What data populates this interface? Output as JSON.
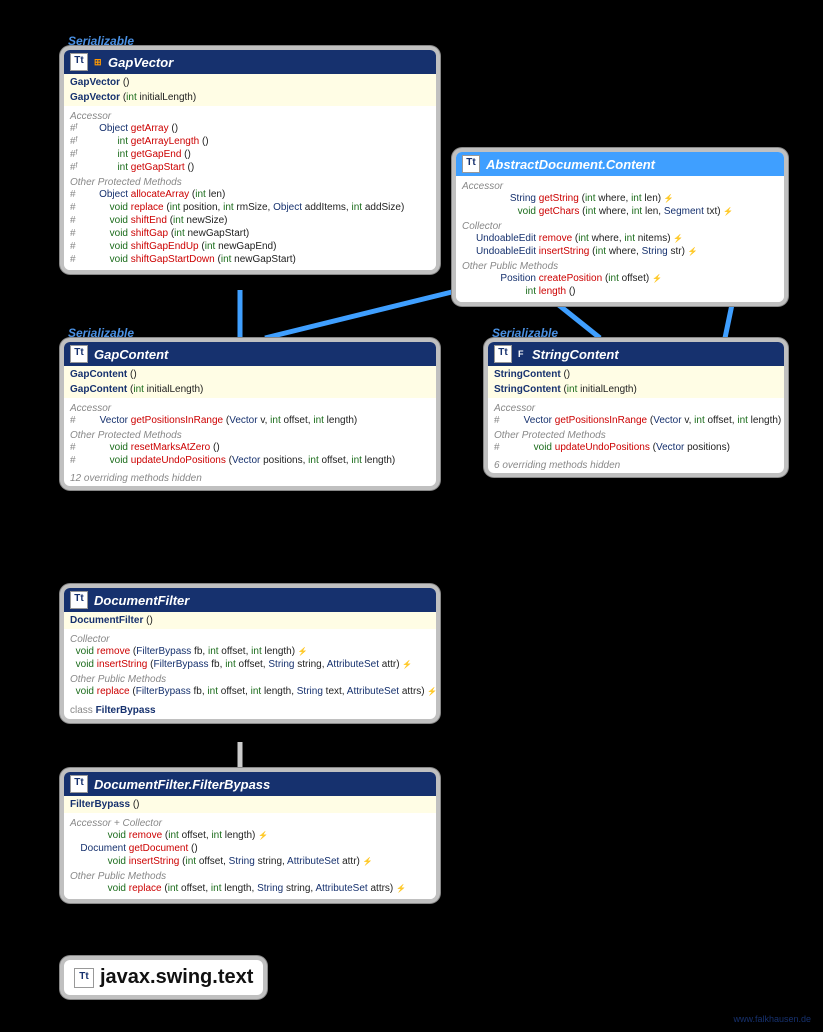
{
  "footer": "www.falkhausen.de",
  "serializable_label": "Serializable",
  "package": "javax.swing.text",
  "boxes": {
    "gapvector": {
      "title": "GapVector",
      "constructors": [
        {
          "name": "GapVector",
          "params": "()"
        },
        {
          "name": "GapVector",
          "params_html": "(<span class='param-primitive'>int</span> initialLength)"
        }
      ],
      "sections": [
        {
          "label": "Accessor",
          "rows": [
            {
              "mod": "#ᶠ",
              "ret": "Object",
              "name": "getArray",
              "params": "()"
            },
            {
              "mod": "#ᶠ",
              "ret": "int",
              "retprim": true,
              "name": "getArrayLength",
              "params": "()"
            },
            {
              "mod": "#ᶠ",
              "ret": "int",
              "retprim": true,
              "name": "getGapEnd",
              "params": "()"
            },
            {
              "mod": "#ᶠ",
              "ret": "int",
              "retprim": true,
              "name": "getGapStart",
              "params": "()"
            }
          ]
        },
        {
          "label": "Other Protected Methods",
          "rows": [
            {
              "mod": "#",
              "ret": "Object",
              "name": "allocateArray",
              "params_html": "(<span class='param-primitive'>int</span> len)"
            },
            {
              "mod": "#",
              "ret": "void",
              "retprim": true,
              "name": "replace",
              "params_html": "(<span class='param-primitive'>int</span> position, <span class='param-primitive'>int</span> rmSize, <span class='param-type'>Object</span> addItems, <span class='param-primitive'>int</span> addSize)"
            },
            {
              "mod": "#",
              "ret": "void",
              "retprim": true,
              "name": "shiftEnd",
              "params_html": "(<span class='param-primitive'>int</span> newSize)"
            },
            {
              "mod": "#",
              "ret": "void",
              "retprim": true,
              "name": "shiftGap",
              "params_html": "(<span class='param-primitive'>int</span> newGapStart)"
            },
            {
              "mod": "#",
              "ret": "void",
              "retprim": true,
              "name": "shiftGapEndUp",
              "params_html": "(<span class='param-primitive'>int</span> newGapEnd)"
            },
            {
              "mod": "#",
              "ret": "void",
              "retprim": true,
              "name": "shiftGapStartDown",
              "params_html": "(<span class='param-primitive'>int</span> newGapStart)"
            }
          ]
        }
      ]
    },
    "absdoc": {
      "title": "AbstractDocument.Content",
      "sections": [
        {
          "label": "Accessor",
          "rows": [
            {
              "ret": "String",
              "name": "getString",
              "params_html": "(<span class='param-primitive'>int</span> where, <span class='param-primitive'>int</span> len)",
              "throws": true,
              "retw": 74
            },
            {
              "ret": "void",
              "retprim": true,
              "name": "getChars",
              "params_html": "(<span class='param-primitive'>int</span> where, <span class='param-primitive'>int</span> len, <span class='param-type'>Segment</span> txt)",
              "throws": true,
              "retw": 74
            }
          ]
        },
        {
          "label": "Collector",
          "rows": [
            {
              "ret": "UndoableEdit",
              "name": "remove",
              "params_html": "(<span class='param-primitive'>int</span> where, <span class='param-primitive'>int</span> nitems)",
              "throws": true,
              "retw": 74
            },
            {
              "ret": "UndoableEdit",
              "name": "insertString",
              "params_html": "(<span class='param-primitive'>int</span> where, <span class='param-type'>String</span> str)",
              "throws": true,
              "retw": 74
            }
          ]
        },
        {
          "label": "Other Public Methods",
          "rows": [
            {
              "ret": "Position",
              "name": "createPosition",
              "params_html": "(<span class='param-primitive'>int</span> offset)",
              "throws": true,
              "retw": 74
            },
            {
              "ret": "int",
              "retprim": true,
              "name": "length",
              "params": "()",
              "retw": 74
            }
          ]
        }
      ]
    },
    "gapcontent": {
      "title": "GapContent",
      "constructors": [
        {
          "name": "GapContent",
          "params": "()"
        },
        {
          "name": "GapContent",
          "params_html": "(<span class='param-primitive'>int</span> initialLength)"
        }
      ],
      "sections": [
        {
          "label": "Accessor",
          "rows": [
            {
              "mod": "#",
              "ret": "Vector",
              "name": "getPositionsInRange",
              "params_html": "(<span class='param-type'>Vector</span> v, <span class='param-primitive'>int</span> offset, <span class='param-primitive'>int</span> length)"
            }
          ]
        },
        {
          "label": "Other Protected Methods",
          "rows": [
            {
              "mod": "#",
              "ret": "void",
              "retprim": true,
              "name": "resetMarksAtZero",
              "params": "()"
            },
            {
              "mod": "#",
              "ret": "void",
              "retprim": true,
              "name": "updateUndoPositions",
              "params_html": "(<span class='param-type'>Vector</span> positions, <span class='param-primitive'>int</span> offset, <span class='param-primitive'>int</span> length)"
            }
          ]
        }
      ],
      "hidden": "12 overriding methods hidden"
    },
    "stringcontent": {
      "title": "StringContent",
      "constructors": [
        {
          "name": "StringContent",
          "params": "()"
        },
        {
          "name": "StringContent",
          "params_html": "(<span class='param-primitive'>int</span> initialLength)"
        }
      ],
      "sections": [
        {
          "label": "Accessor",
          "rows": [
            {
              "mod": "#",
              "ret": "Vector",
              "name": "getPositionsInRange",
              "params_html": "(<span class='param-type'>Vector</span> v, <span class='param-primitive'>int</span> offset, <span class='param-primitive'>int</span> length)"
            }
          ]
        },
        {
          "label": "Other Protected Methods",
          "rows": [
            {
              "mod": "#",
              "ret": "void",
              "retprim": true,
              "name": "updateUndoPositions",
              "params_html": "(<span class='param-type'>Vector</span> positions)"
            }
          ]
        }
      ],
      "hidden": "6 overriding methods hidden"
    },
    "docfilter": {
      "title": "DocumentFilter",
      "constructors": [
        {
          "name": "DocumentFilter",
          "params": "()"
        }
      ],
      "sections": [
        {
          "label": "Collector",
          "rows": [
            {
              "ret": "void",
              "retprim": true,
              "name": "remove",
              "params_html": "(<span class='param-type'>FilterBypass</span> fb, <span class='param-primitive'>int</span> offset, <span class='param-primitive'>int</span> length)",
              "throws": true
            },
            {
              "ret": "void",
              "retprim": true,
              "name": "insertString",
              "params_html": "(<span class='param-type'>FilterBypass</span> fb, <span class='param-primitive'>int</span> offset, <span class='param-type'>String</span> string, <span class='param-type'>AttributeSet</span> attr)",
              "throws": true
            }
          ]
        },
        {
          "label": "Other Public Methods",
          "rows": [
            {
              "ret": "void",
              "retprim": true,
              "name": "replace",
              "params_html": "(<span class='param-type'>FilterBypass</span> fb, <span class='param-primitive'>int</span> offset, <span class='param-primitive'>int</span> length, <span class='param-type'>String</span> text, <span class='param-type'>AttributeSet</span> attrs)",
              "throws": true
            }
          ]
        }
      ],
      "inner": "class FilterBypass"
    },
    "filterbypass": {
      "title": "DocumentFilter.FilterBypass",
      "constructors": [
        {
          "name": "FilterBypass",
          "params": "()"
        }
      ],
      "sections": [
        {
          "label": "Accessor + Collector",
          "rows": [
            {
              "ret": "void",
              "retprim": true,
              "name": "remove",
              "params_html": "(<span class='param-primitive'>int</span> offset, <span class='param-primitive'>int</span> length)",
              "throws": true,
              "retw": 56
            },
            {
              "ret": "Document",
              "name": "getDocument",
              "params": "()",
              "retw": 56
            },
            {
              "ret": "void",
              "retprim": true,
              "name": "insertString",
              "params_html": "(<span class='param-primitive'>int</span> offset, <span class='param-type'>String</span> string, <span class='param-type'>AttributeSet</span> attr)",
              "throws": true,
              "retw": 56
            }
          ]
        },
        {
          "label": "Other Public Methods",
          "rows": [
            {
              "ret": "void",
              "retprim": true,
              "name": "replace",
              "params_html": "(<span class='param-primitive'>int</span> offset, <span class='param-primitive'>int</span> length, <span class='param-type'>String</span> string, <span class='param-type'>AttributeSet</span> attrs)",
              "throws": true,
              "retw": 56
            }
          ]
        }
      ]
    }
  }
}
